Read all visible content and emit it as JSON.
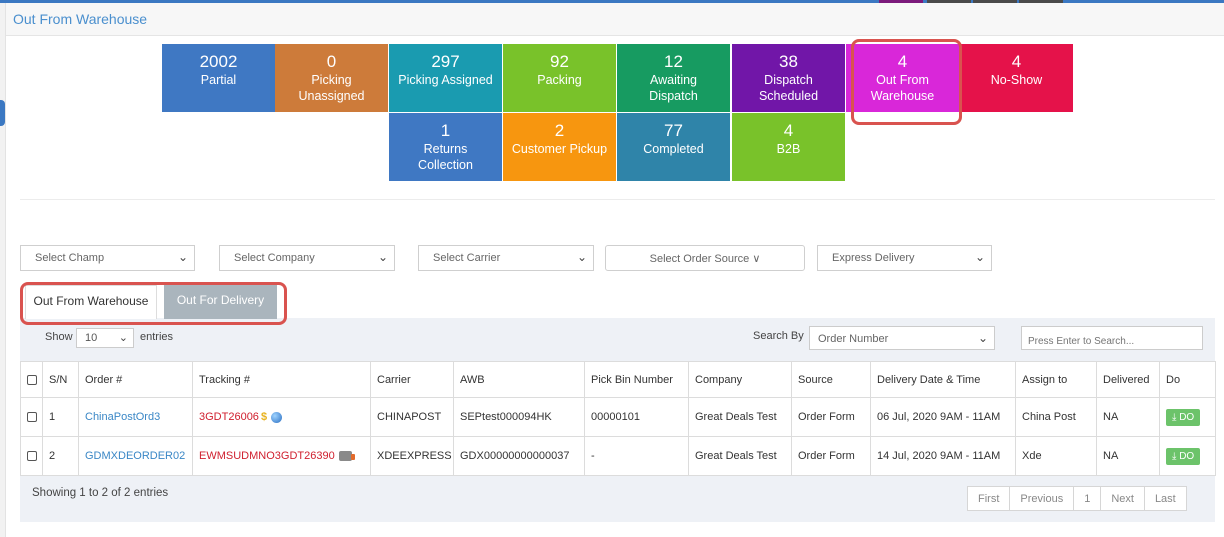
{
  "header": {
    "title": "Out From Warehouse"
  },
  "status_tiles": [
    {
      "count": "2002",
      "label_lines": [
        "Partial"
      ],
      "color": "#3f78c3"
    },
    {
      "count": "0",
      "label_lines": [
        "Picking",
        "Unassigned"
      ],
      "color": "#cd7b3a"
    },
    {
      "count": "297",
      "label_lines": [
        "Picking Assigned"
      ],
      "color": "#1a9bb0"
    },
    {
      "count": "92",
      "label_lines": [
        "Packing"
      ],
      "color": "#79c22a"
    },
    {
      "count": "12",
      "label_lines": [
        "Awaiting",
        "Dispatch"
      ],
      "color": "#179b61"
    },
    {
      "count": "38",
      "label_lines": [
        "Dispatch",
        "Scheduled"
      ],
      "color": "#7116a8"
    },
    {
      "count": "4",
      "label_lines": [
        "Out From",
        "Warehouse"
      ],
      "color": "#d927d9"
    },
    {
      "count": "4",
      "label_lines": [
        "No-Show"
      ],
      "color": "#e5124a"
    },
    {
      "count": "1",
      "label_lines": [
        "Returns",
        "Collection"
      ],
      "color": "#3f78c3"
    },
    {
      "count": "2",
      "label_lines": [
        "Customer Pickup"
      ],
      "color": "#f7960f"
    },
    {
      "count": "77",
      "label_lines": [
        "Completed"
      ],
      "color": "#2f84a9"
    },
    {
      "count": "4",
      "label_lines": [
        "B2B"
      ],
      "color": "#79c22a"
    }
  ],
  "filters": {
    "champ": "Select Champ",
    "company": "Select Company",
    "carrier": "Select Carrier",
    "order_source": "Select Order Source ∨",
    "express": "Express Delivery"
  },
  "tabs": {
    "active": "Out From Warehouse",
    "inactive": "Out For Delivery"
  },
  "list_controls": {
    "show": "Show",
    "entries_value": "10",
    "entries": "entries",
    "search_by": "Search By",
    "search_field": "Order Number",
    "search_placeholder": "Press Enter to Search..."
  },
  "table": {
    "headers": [
      "S/N",
      "Order #",
      "Tracking #",
      "Carrier",
      "AWB",
      "Pick Bin Number",
      "Company",
      "Source",
      "Delivery Date & Time",
      "Assign to",
      "Delivered",
      "Do"
    ],
    "rows": [
      {
        "sn": "1",
        "order": "ChinaPostOrd3",
        "tracking": "3GDT26006",
        "tracking_icons": [
          "dollar-icon",
          "globe-icon"
        ],
        "carrier": "CHINAPOST",
        "awb": "SEPtest000094HK",
        "bin": "00000101",
        "company": "Great Deals Test",
        "source": "Order Form",
        "delivery": "06 Jul, 2020 9AM - 11AM",
        "assign": "China Post",
        "delivered": "NA",
        "do": "DO"
      },
      {
        "sn": "2",
        "order": "GDMXDEORDER02",
        "tracking": "EWMSUDMNO3GDT26390",
        "tracking_icons": [
          "truck-icon"
        ],
        "carrier": "XDEEXPRESS",
        "awb": "GDX00000000000037",
        "bin": "-",
        "company": "Great Deals Test",
        "source": "Order Form",
        "delivery": "14 Jul, 2020 9AM - 11AM",
        "assign": "Xde",
        "delivered": "NA",
        "do": "DO"
      }
    ],
    "action_icon": "download-icon"
  },
  "footer": {
    "info": "Showing 1 to 2 of 2 entries",
    "pager": [
      "First",
      "Previous",
      "1",
      "Next",
      "Last"
    ]
  },
  "colors": {
    "accent": "#3b78c2",
    "highlight": "#d9534f",
    "do_button": "#6cc36a",
    "link": "#3a87c6",
    "tracking": "#d0202f"
  }
}
